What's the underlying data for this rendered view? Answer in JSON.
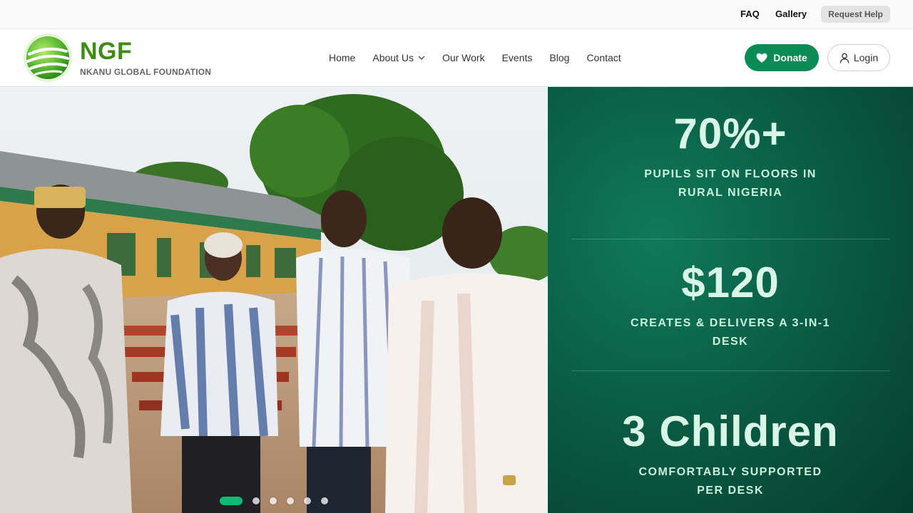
{
  "topbar": {
    "faq": "FAQ",
    "gallery": "Gallery",
    "request_help": "Request Help"
  },
  "brand": {
    "abbr": "NGF",
    "name": "NKANU GLOBAL FOUNDATION",
    "color": "#3e8c14"
  },
  "nav": {
    "items": [
      {
        "label": "Home"
      },
      {
        "label": "About Us",
        "has_dropdown": true
      },
      {
        "label": "Our Work"
      },
      {
        "label": "Events"
      },
      {
        "label": "Blog"
      },
      {
        "label": "Contact"
      }
    ]
  },
  "actions": {
    "donate": "Donate",
    "login": "Login",
    "donate_color": "#0a8a55"
  },
  "carousel": {
    "slide_count": 6,
    "active_index": 0,
    "active_color": "#0bbd74"
  },
  "stats": [
    {
      "value": "70%+",
      "caption_line1": "PUPILS SIT ON FLOORS IN",
      "caption_line2": "RURAL NIGERIA"
    },
    {
      "value": "$120",
      "caption_line1": "CREATES & DELIVERS A 3-IN-1",
      "caption_line2": "DESK"
    },
    {
      "value": "3 Children",
      "caption_line1": "COMFORTABLY SUPPORTED",
      "caption_line2": "PER DESK"
    }
  ],
  "icons": {
    "logo": "globe-logo-icon",
    "chevron": "chevron-down-icon",
    "heart": "heart-icon",
    "user": "user-icon"
  }
}
